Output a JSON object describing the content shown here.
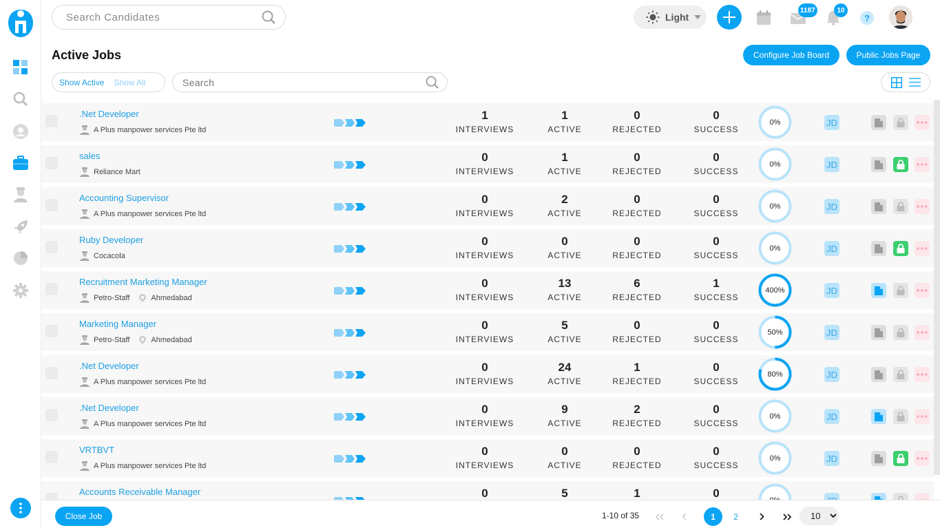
{
  "app": {
    "logo_name": "brand-logo",
    "accent": "#0ba4f3"
  },
  "sidebar": {
    "items": [
      {
        "name": "dashboard-icon"
      },
      {
        "name": "search-icon"
      },
      {
        "name": "candidate-icon"
      },
      {
        "name": "briefcase-icon"
      },
      {
        "name": "recruiter-icon"
      },
      {
        "name": "rocket-icon"
      },
      {
        "name": "pie-chart-icon"
      },
      {
        "name": "gear-icon"
      }
    ]
  },
  "header": {
    "search_placeholder": "Search Candidates",
    "theme_label": "Light",
    "mail_badge": "1187",
    "notification_badge": "10",
    "help_label": "?"
  },
  "page": {
    "title": "Active Jobs",
    "configure_label": "Configure Job Board",
    "public_label": "Public Jobs Page",
    "show_active": "Show Active",
    "show_all": "Show All",
    "search_placeholder": "Search"
  },
  "labels": {
    "interviews": "INTERVIEWS",
    "active": "ACTIVE",
    "rejected": "REJECTED",
    "success": "SUCCESS",
    "jd": "JD"
  },
  "jobs": [
    {
      "title": ".Net Developer",
      "company": "A Plus manpower services Pte ltd",
      "location": "",
      "interviews": "1",
      "active": "1",
      "rejected": "0",
      "success": "0",
      "percent": "0%",
      "progress": 0,
      "doc_active": false,
      "lock_open": false
    },
    {
      "title": "sales",
      "company": "Reliance Mart",
      "location": "",
      "interviews": "0",
      "active": "1",
      "rejected": "0",
      "success": "0",
      "percent": "0%",
      "progress": 0,
      "doc_active": false,
      "lock_open": true
    },
    {
      "title": "Accounting Supervisor",
      "company": "A Plus manpower services Pte ltd",
      "location": "",
      "interviews": "0",
      "active": "2",
      "rejected": "0",
      "success": "0",
      "percent": "0%",
      "progress": 0,
      "doc_active": false,
      "lock_open": false
    },
    {
      "title": "Ruby Developer",
      "company": "Cocacola",
      "location": "",
      "interviews": "0",
      "active": "0",
      "rejected": "0",
      "success": "0",
      "percent": "0%",
      "progress": 0,
      "doc_active": false,
      "lock_open": true
    },
    {
      "title": "Recruitment Marketing Manager",
      "company": "Petro-Staff",
      "location": "Ahmedabad",
      "interviews": "0",
      "active": "13",
      "rejected": "6",
      "success": "1",
      "percent": "400%",
      "progress": 1,
      "doc_active": true,
      "lock_open": false
    },
    {
      "title": "Marketing Manager",
      "company": "Petro-Staff",
      "location": "Ahmedabad",
      "interviews": "0",
      "active": "5",
      "rejected": "0",
      "success": "0",
      "percent": "50%",
      "progress": 0.5,
      "doc_active": false,
      "lock_open": false
    },
    {
      "title": ".Net Developer",
      "company": "A Plus manpower services Pte ltd",
      "location": "",
      "interviews": "0",
      "active": "24",
      "rejected": "1",
      "success": "0",
      "percent": "80%",
      "progress": 0.8,
      "doc_active": false,
      "lock_open": false
    },
    {
      "title": ".Net Developer",
      "company": "A Plus manpower services Pte ltd",
      "location": "",
      "interviews": "0",
      "active": "9",
      "rejected": "2",
      "success": "0",
      "percent": "0%",
      "progress": 0,
      "doc_active": true,
      "lock_open": false
    },
    {
      "title": "VRTBVT",
      "company": "A Plus manpower services Pte ltd",
      "location": "",
      "interviews": "0",
      "active": "0",
      "rejected": "0",
      "success": "0",
      "percent": "0%",
      "progress": 0,
      "doc_active": false,
      "lock_open": true
    },
    {
      "title": "Accounts Receivable Manager",
      "company": "",
      "location": "",
      "interviews": "0",
      "active": "5",
      "rejected": "1",
      "success": "0",
      "percent": "0%",
      "progress": 0,
      "doc_active": true,
      "lock_open": false
    }
  ],
  "footer": {
    "close_label": "Close Job",
    "range": "1-10 of 35",
    "pages": [
      "1",
      "2"
    ],
    "current_page": "1",
    "per_page": "10"
  }
}
